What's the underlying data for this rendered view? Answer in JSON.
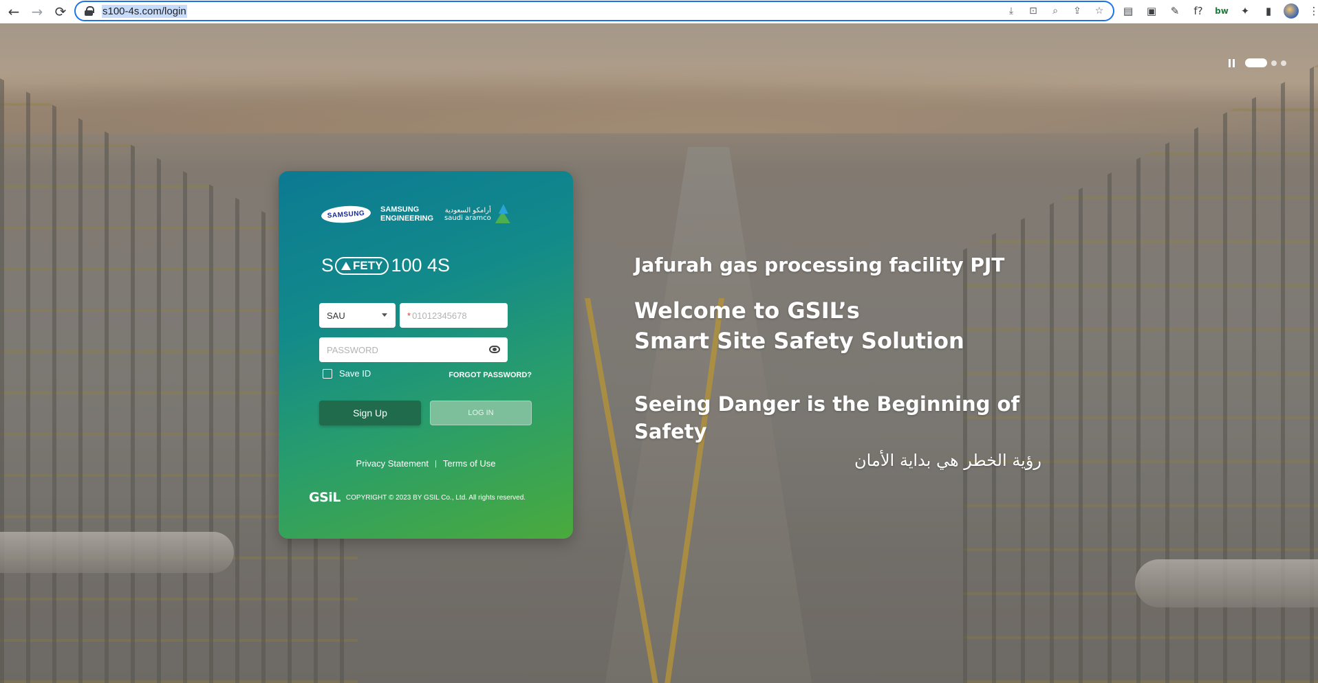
{
  "browser": {
    "url": "s100-4s.com/login",
    "back_glyph": "←",
    "forward_glyph": "→",
    "reload_glyph": "⟳",
    "omnibox_icons": [
      "download-icon",
      "translate-icon",
      "zoom-icon",
      "share-icon",
      "bookmark-star-icon"
    ],
    "omnibox_glyphs": [
      "⤓",
      "⊡",
      "⌕",
      "⇪",
      "☆"
    ],
    "extension_glyphs": [
      "▤",
      "▣",
      "✎",
      "f?",
      "bw",
      "✦",
      "▮",
      "",
      "⋮"
    ]
  },
  "hero": {
    "slider": {
      "slide_count": 3,
      "active_index": 0
    }
  },
  "login": {
    "logos": {
      "samsung": "SAMSUNG",
      "samsung_engineering_line1": "SAMSUNG",
      "samsung_engineering_line2": "ENGINEERING",
      "aramco_arabic": "أرامكو السعودية",
      "aramco_latin": "saudi aramco"
    },
    "brand": {
      "prefix": "S",
      "pill_text": "FETY",
      "suffix": "100 4S"
    },
    "country_select": {
      "value": "SAU"
    },
    "phone": {
      "placeholder": "01012345678",
      "required_mark": "*"
    },
    "password": {
      "placeholder": "PASSWORD"
    },
    "save_id_label": "Save ID",
    "forgot_password": "FORGOT PASSWORD?",
    "signup_label": "Sign Up",
    "login_label": "LOG IN",
    "privacy": "Privacy Statement",
    "separator": "|",
    "terms": "Terms of Use",
    "gsil_logo": "GSiL",
    "copyright": "COPYRIGHT © 2023 BY GSIL Co., Ltd. All rights reserved."
  },
  "headline": {
    "project": "Jafurah gas processing facility PJT",
    "welcome_line1": "Welcome to GSIL’s",
    "welcome_line2": "Smart Site Safety Solution",
    "seeing": "Seeing Danger is the Beginning of Safety",
    "arabic": "رؤية الخطر هي بداية الأمان"
  },
  "colors": {
    "card_gradient_start": "#0c7a93",
    "card_gradient_end": "#4aaa3c",
    "signup_bg": "#1f6b4c",
    "login_bg": "#7dbf9a",
    "omnibox_focus": "#1a73e8"
  }
}
